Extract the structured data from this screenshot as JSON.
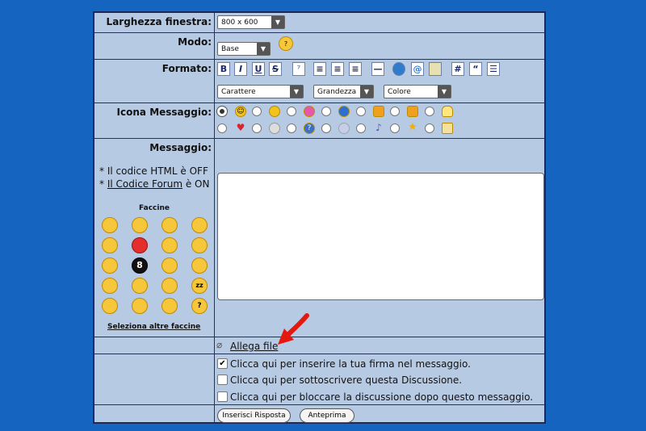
{
  "labels": {
    "window_width": "Larghezza finestra:",
    "mode": "Modo:",
    "format": "Formato:",
    "message_icon": "Icona Messaggio:",
    "message": "Messaggio:"
  },
  "selects": {
    "window_width": "800 x 600",
    "mode": "Base",
    "font": "Carattere",
    "size": "Grandezza",
    "color": "Colore"
  },
  "toolbar": {
    "bold": "B",
    "italic": "I",
    "underline": "U",
    "strike": "S",
    "hash": "#",
    "quote": "“"
  },
  "info": {
    "html_code": "* Il codice HTML è OFF",
    "forum_code_prefix": "* ",
    "forum_code_link": "Il Codice Forum",
    "forum_code_suffix": " è ON"
  },
  "smilies": {
    "title": "Faccine",
    "more_link": "Seleziona altre faccine"
  },
  "attach": {
    "label": "Allega file"
  },
  "options": [
    {
      "label": "Clicca qui per inserire la tua firma nel messaggio.",
      "checked": true
    },
    {
      "label": "Clicca qui per sottoscrivere questa Discussione.",
      "checked": false
    },
    {
      "label": "Clicca qui per bloccare la discussione dopo questo messaggio.",
      "checked": false
    }
  ],
  "buttons": {
    "submit": "Inserisci Risposta",
    "preview": "Anteprima"
  },
  "colors": {
    "background": "#1565c0",
    "panel": "#b7cae4",
    "arrow": "#e5180f"
  }
}
